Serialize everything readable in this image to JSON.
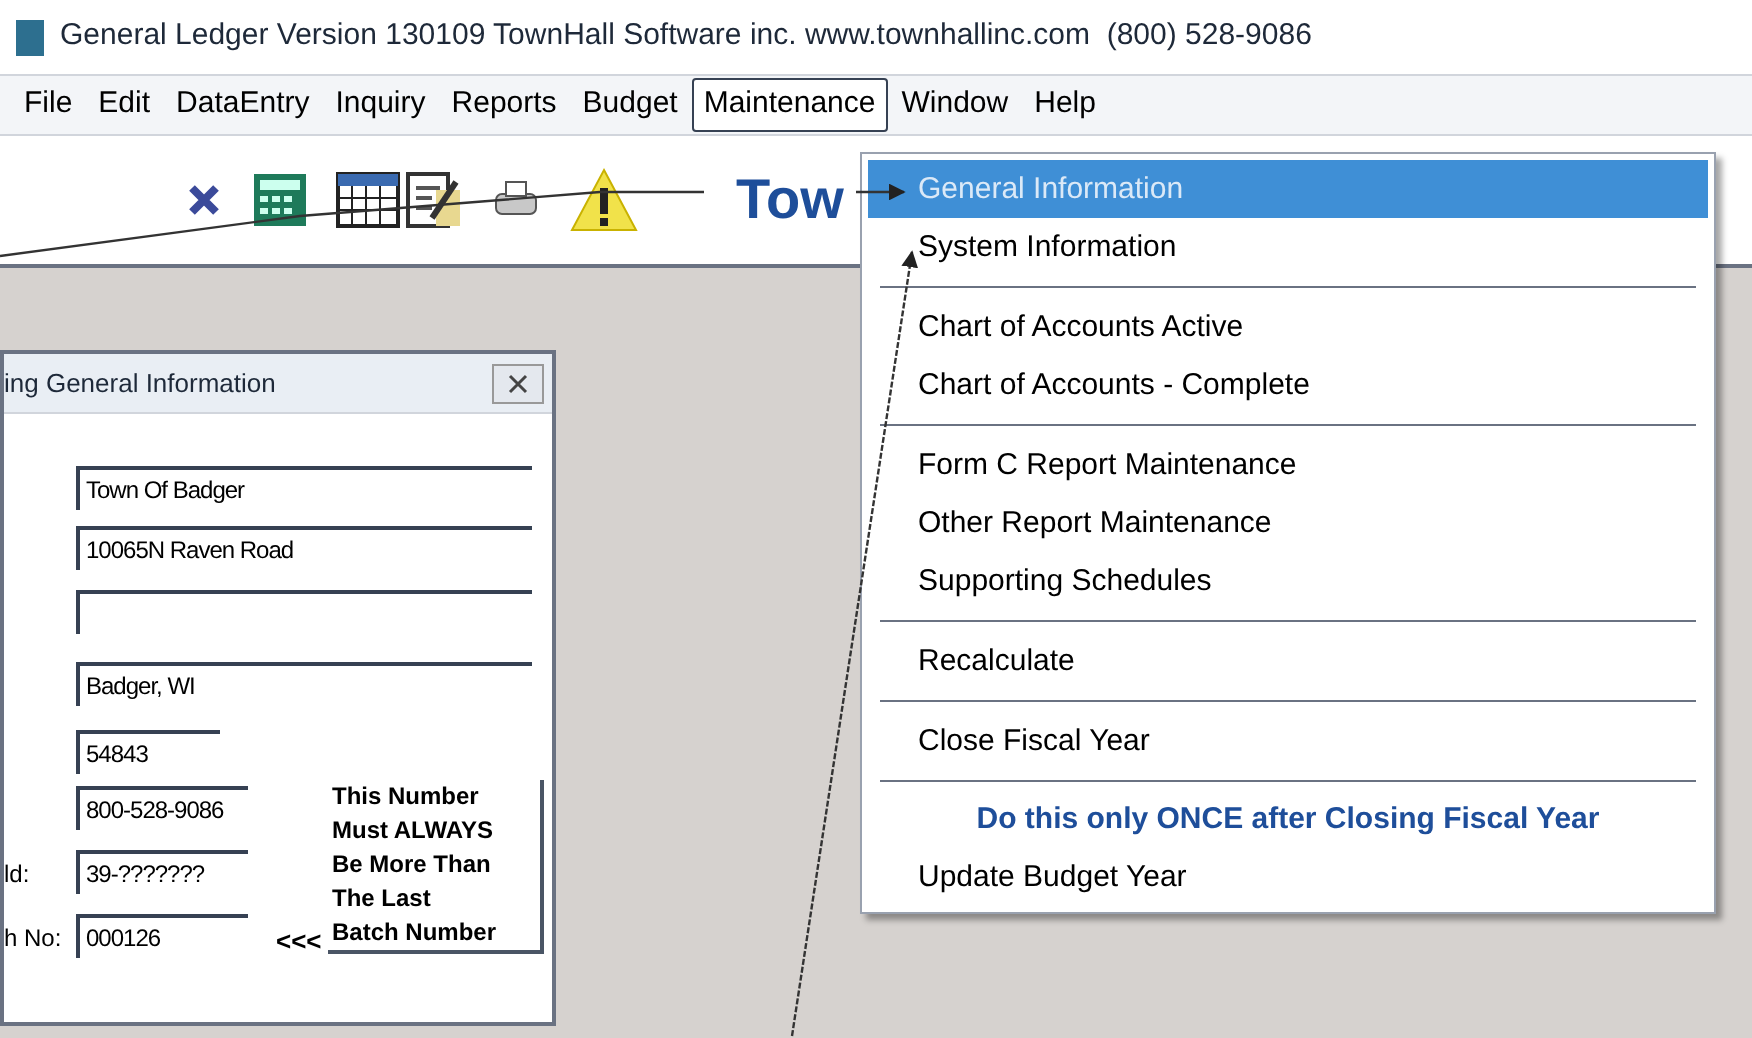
{
  "window": {
    "title": "General Ledger Version 130109 TownHall Software inc. www.townhallinc.com  (800) 528-9086"
  },
  "menu_bar": [
    {
      "label": "File",
      "selected": false
    },
    {
      "label": "Edit",
      "selected": false
    },
    {
      "label": "DataEntry",
      "selected": false
    },
    {
      "label": "Inquiry",
      "selected": false
    },
    {
      "label": "Reports",
      "selected": false
    },
    {
      "label": "Budget",
      "selected": false
    },
    {
      "label": "Maintenance",
      "selected": true
    },
    {
      "label": "Window",
      "selected": false
    },
    {
      "label": "Help",
      "selected": false
    }
  ],
  "toolbar": {
    "banner_text": "Tow"
  },
  "dialog": {
    "title": "ing General Information",
    "fields": [
      {
        "kind": "filled",
        "value": "Town Of Badger"
      },
      {
        "kind": "filled",
        "value": "10065N Raven Road"
      },
      {
        "kind": "blank"
      },
      {
        "kind": "filled",
        "value": "Badger, WI"
      },
      {
        "kind": "filled",
        "value": "54843"
      },
      {
        "kind": "filled",
        "value": "800-528-9086"
      },
      {
        "kind": "filled",
        "label": "ld:",
        "value": "39-???????"
      },
      {
        "kind": "filled",
        "label": "h No:",
        "value": "000126"
      }
    ],
    "pointer": "<<<",
    "note": "This Number\nMust ALWAYS\nBe More Than\nThe Last\nBatch Number"
  },
  "dropdown": [
    {
      "kind": "item",
      "label": "General Information",
      "selected": true
    },
    {
      "kind": "item",
      "label": "System Information",
      "selected": false
    },
    {
      "kind": "separator"
    },
    {
      "kind": "item",
      "label": "Chart of Accounts Active",
      "selected": false
    },
    {
      "kind": "item",
      "label": "Chart of Accounts - Complete",
      "selected": false
    },
    {
      "kind": "separator"
    },
    {
      "kind": "item",
      "label": "Form C Report Maintenance",
      "selected": false
    },
    {
      "kind": "item",
      "label": "Other Report Maintenance",
      "selected": false
    },
    {
      "kind": "item",
      "label": "Supporting Schedules",
      "selected": false
    },
    {
      "kind": "separator"
    },
    {
      "kind": "item",
      "label": "Recalculate",
      "selected": false
    },
    {
      "kind": "separator"
    },
    {
      "kind": "item",
      "label": "Close Fiscal Year",
      "selected": false
    },
    {
      "kind": "separator"
    },
    {
      "kind": "note",
      "label": "Do this only ONCE after Closing Fiscal Year"
    },
    {
      "kind": "item",
      "label": "Update Budget Year",
      "selected": false
    }
  ]
}
